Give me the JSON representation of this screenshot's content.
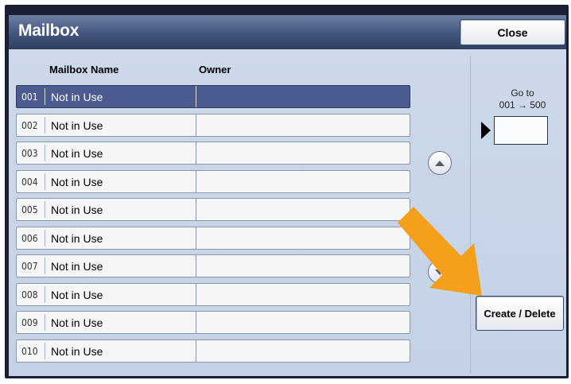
{
  "window": {
    "title": "Mailbox",
    "close_label": "Close"
  },
  "table": {
    "columns": [
      "Mailbox Name",
      "Owner"
    ],
    "rows": [
      {
        "number": "001",
        "name": "Not in Use",
        "owner": "",
        "selected": true
      },
      {
        "number": "002",
        "name": "Not in Use",
        "owner": ""
      },
      {
        "number": "003",
        "name": "Not in Use",
        "owner": ""
      },
      {
        "number": "004",
        "name": "Not in Use",
        "owner": ""
      },
      {
        "number": "005",
        "name": "Not in Use",
        "owner": ""
      },
      {
        "number": "006",
        "name": "Not in Use",
        "owner": ""
      },
      {
        "number": "007",
        "name": "Not in Use",
        "owner": ""
      },
      {
        "number": "008",
        "name": "Not in Use",
        "owner": ""
      },
      {
        "number": "009",
        "name": "Not in Use",
        "owner": ""
      },
      {
        "number": "010",
        "name": "Not in Use",
        "owner": ""
      }
    ]
  },
  "scroll": {
    "up_icon": "chevron-up-icon",
    "down_icon": "chevron-down-icon"
  },
  "goto": {
    "label": "Go to",
    "range": "001 → 500",
    "value": ""
  },
  "actions": {
    "create_delete_label": "Create / Delete"
  },
  "annotation": {
    "icon": "pointer-arrow-icon",
    "color": "#f5a01a"
  },
  "colors": {
    "titlebar": "#43557d",
    "panel": "#c9d6e8",
    "selected_row": "#4b5a8f"
  }
}
